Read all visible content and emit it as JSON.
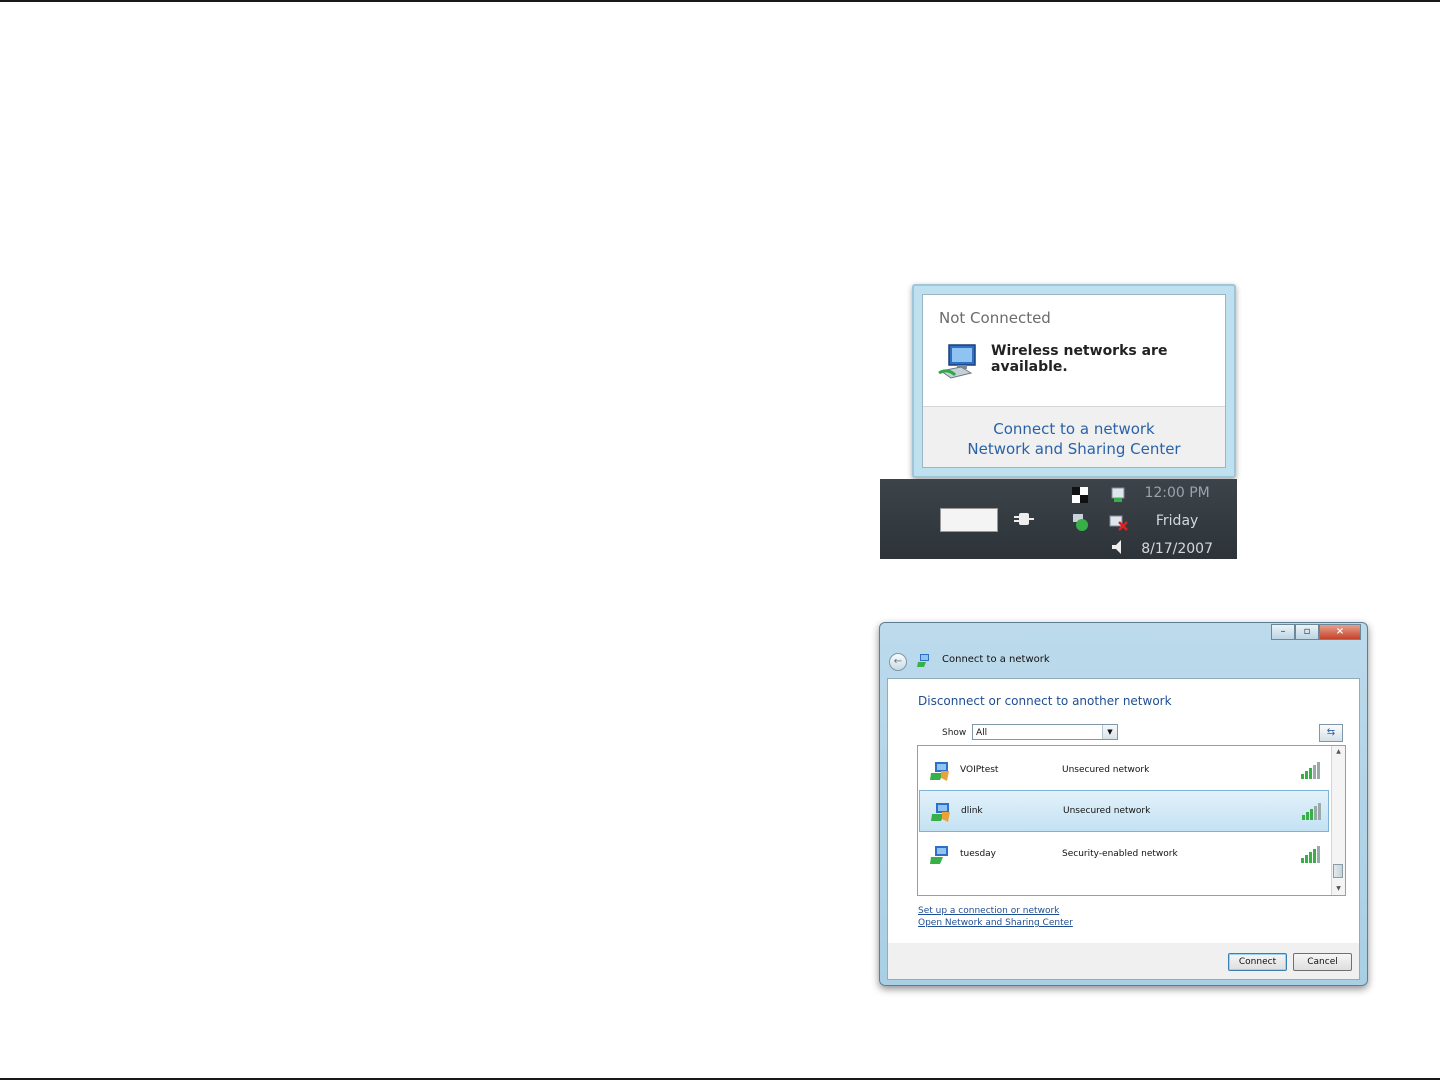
{
  "popup": {
    "title": "Not Connected",
    "message": "Wireless networks are available.",
    "links": [
      "Connect to a network",
      "Network and Sharing Center"
    ]
  },
  "taskbar": {
    "time": "12:00 PM",
    "day": "Friday",
    "date": "8/17/2007"
  },
  "window": {
    "title": "Connect to a network",
    "subtitle": "Disconnect or connect to another network",
    "show_label": "Show",
    "show_value": "All",
    "networks": [
      {
        "name": "VOIPtest",
        "security": "Unsecured network"
      },
      {
        "name": "dlink",
        "security": "Unsecured network",
        "selected": true
      },
      {
        "name": "tuesday",
        "security": "Security-enabled network"
      }
    ],
    "links": [
      "Set up a connection or network",
      "Open Network and Sharing Center"
    ],
    "buttons": {
      "connect": "Connect",
      "cancel": "Cancel"
    }
  },
  "colors": {
    "link": "#2a62a8",
    "selection": "#c4e2f3",
    "taskbar": "#2d3338"
  }
}
